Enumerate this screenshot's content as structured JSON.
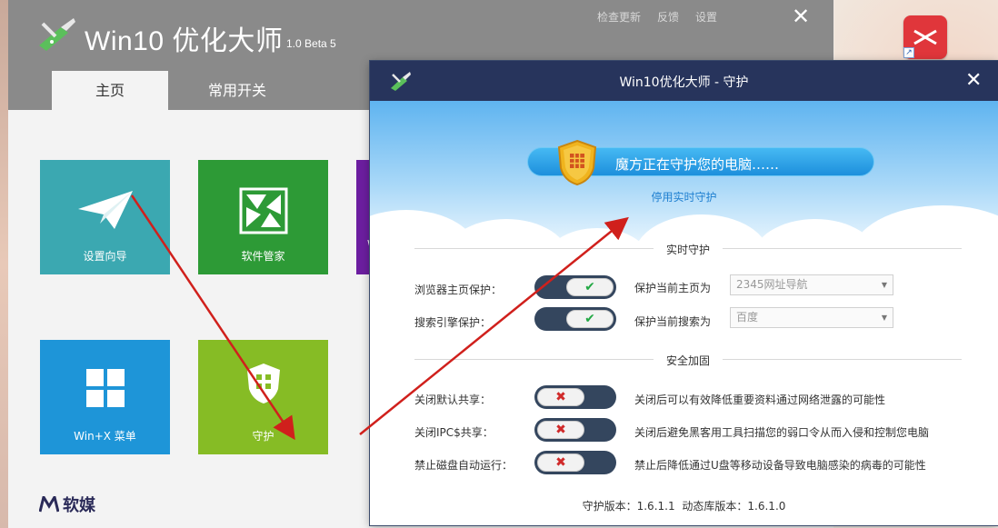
{
  "main": {
    "title": "Win10 优化大师",
    "version": "1.0 Beta 5",
    "links": [
      "检查更新",
      "反馈",
      "设置"
    ],
    "close": "✕",
    "tabs": [
      "主页",
      "常用开关"
    ],
    "tiles": {
      "wizard": "设置向导",
      "software": "软件管家",
      "purple": "W",
      "winx": "Win+X 菜单",
      "guard": "守护"
    },
    "watermark": "软媒"
  },
  "guard": {
    "title": "Win10优化大师 - 守护",
    "close": "✕",
    "status": "魔方正在守护您的电脑……",
    "disable_link": "停用实时守护",
    "section_realtime": "实时守护",
    "section_security": "安全加固",
    "realtime": [
      {
        "label": "浏览器主页保护：",
        "state": "on",
        "mark": "✔",
        "field": "保护当前主页为",
        "value": "2345网址导航"
      },
      {
        "label": "搜索引擎保护：",
        "state": "on",
        "mark": "✔",
        "field": "保护当前搜索为",
        "value": "百度"
      }
    ],
    "security": [
      {
        "label": "关闭默认共享：",
        "state": "off",
        "mark": "✖",
        "desc": "关闭后可以有效降低重要资料通过网络泄露的可能性"
      },
      {
        "label": "关闭IPC$共享：",
        "state": "off",
        "mark": "✖",
        "desc": "关闭后避免黑客用工具扫描您的弱口令从而入侵和控制您电脑"
      },
      {
        "label": "禁止磁盘自动运行：",
        "state": "off",
        "mark": "✖",
        "desc": "禁止后降低通过U盘等移动设备导致电脑感染的病毒的可能性"
      }
    ],
    "footer": "守护版本：1.6.1.1   动态库版本：1.6.1.0"
  },
  "colors": {
    "header_gray": "#8a8a8a",
    "tile_teal": "#3ba8b1",
    "tile_green": "#2d9a36",
    "tile_purple": "#6c1ea0",
    "tile_blue": "#1e95d8",
    "tile_lime": "#86bc25",
    "dialog_titlebar": "#27345c",
    "toggle_track": "#34465e",
    "arrow_red": "#d0201c"
  }
}
